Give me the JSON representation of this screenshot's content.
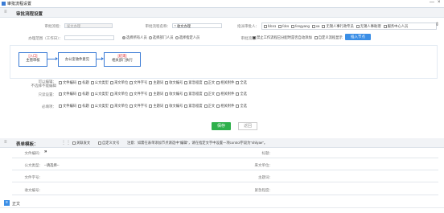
{
  "window": {
    "title": "审批流程设置",
    "minimize": "—",
    "close": "×"
  },
  "section1": {
    "title": "审批流程设置",
    "menu_icon": "menu-icon"
  },
  "form": {
    "row1": {
      "name_label": "审批流程：",
      "name_value": "发文办理",
      "type_label": "审批流程名称：",
      "type_value": "* 收文办理",
      "handler_label": "指派审批人：",
      "handlers": [
        {
          "label": "fdcs1",
          "checked": false
        },
        {
          "label": "fdcs",
          "checked": false
        },
        {
          "label": "fengyang",
          "checked": false
        },
        {
          "label": "xa",
          "checked": false
        },
        {
          "label": "无锡人事行政专员",
          "checked": false
        },
        {
          "label": "无锡人事助理",
          "checked": false
        },
        {
          "label": "服务中心人员",
          "checked": false
        }
      ]
    },
    "row2": {
      "scope_label": "办理范围（工作日）：",
      "scope_options": [
        {
          "label": "选择所有人员",
          "checked": true
        },
        {
          "label": "选择部门人员",
          "checked": false
        },
        {
          "label": "选择指定人员",
          "checked": false
        }
      ],
      "flow_label": "审批流程：",
      "flow_options": [
        {
          "label": "禁止工作流程已分配时是否自动添加",
          "checked": true
        },
        {
          "label": "自定义流程显示",
          "checked": false
        }
      ],
      "insert_button": "插入节点"
    }
  },
  "flowchart": {
    "nodes": [
      {
        "title": "[入口]",
        "sub": "主管审核",
        "color": "#d9282f"
      },
      {
        "title": "办公室收件意见",
        "sub": "",
        "color": "#333"
      },
      {
        "title": "[结束]",
        "sub": "相关部门执行",
        "color": "#d9282f"
      }
    ]
  },
  "permissions": {
    "rows": [
      {
        "label": "可以编辑：",
        "sub": "不选择不能编辑",
        "items": [
          "文件编码",
          "标题",
          "公文类型",
          "来文单位",
          "文件字号",
          "主题词",
          "收文编号",
          "紧急程度",
          "正文",
          "相关附件",
          "全选"
        ]
      },
      {
        "label": "只读设置：",
        "sub": "",
        "items": [
          "文件编码",
          "标题",
          "公文类型",
          "来文单位",
          "文件字号",
          "主题词",
          "收文编号",
          "紧急程度",
          "正文",
          "相关附件",
          "全选"
        ]
      },
      {
        "label": "必填项：",
        "sub": "",
        "items": [
          "文件编码",
          "标题",
          "公文类型",
          "来文单位",
          "文件字号",
          "主题词",
          "收文编号",
          "紧急程度",
          "正文",
          "相关附件",
          "全选"
        ]
      }
    ]
  },
  "actions": {
    "save": "保存",
    "back": "返回"
  },
  "section2": {
    "title": "表单模板：",
    "option1": "关联发文",
    "option2": "自定义文号",
    "hint": "注意：如需在表单添加节点请选中\"编辑\"，请在指定文字中设置一项control字段为\"shilyae\"。"
  },
  "doc_form": {
    "fields": [
      {
        "left_label": "文件编码：",
        "left_value": "»",
        "right_label": "标题：",
        "right_value": ""
      },
      {
        "left_label": "公文类型：",
        "left_value": "--请选择--",
        "right_label": "来文单位：",
        "right_value": ""
      },
      {
        "left_label": "文件字号：",
        "left_value": "",
        "right_label": "主题词：",
        "right_value": ""
      },
      {
        "left_label": "收文编号：",
        "left_value": "",
        "right_label": "紧急程度：",
        "right_value": ""
      }
    ],
    "body_label": "正文"
  }
}
